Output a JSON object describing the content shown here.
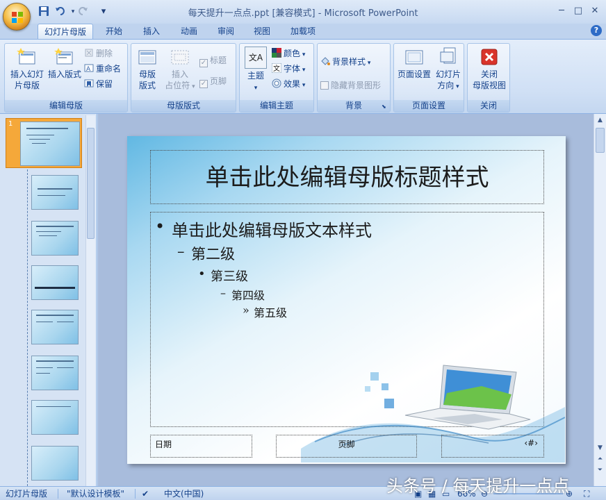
{
  "window": {
    "title": "每天提升一点点.ppt [兼容模式] - Microsoft PowerPoint",
    "minimize": "─",
    "restore": "□",
    "close": "✕"
  },
  "quick_access": {
    "save_icon": "save-icon",
    "undo_icon": "undo-icon",
    "redo_icon": "redo-icon",
    "customize": "▾"
  },
  "tabs": [
    {
      "label": "幻灯片母版",
      "active": true
    },
    {
      "label": "开始"
    },
    {
      "label": "插入"
    },
    {
      "label": "动画"
    },
    {
      "label": "审阅"
    },
    {
      "label": "视图"
    },
    {
      "label": "加载项"
    }
  ],
  "help": "?",
  "ribbon": {
    "edit_master": {
      "label": "编辑母版",
      "insert_master_l1": "插入幻灯",
      "insert_master_l2": "片母版",
      "insert_layout": "插入版式",
      "delete": "删除",
      "rename": "重命名",
      "preserve": "保留"
    },
    "master_layout": {
      "label": "母版版式",
      "layout_l1": "母版",
      "layout_l2": "版式",
      "placeholder_l1": "插入",
      "placeholder_l2": "占位符",
      "title_cb": "标题",
      "footer_cb": "页脚"
    },
    "edit_theme": {
      "label": "编辑主题",
      "themes": "主题",
      "colors": "颜色",
      "fonts": "字体",
      "effects": "效果",
      "theme_icon_text": "文A"
    },
    "background": {
      "label": "背景",
      "styles": "背景样式",
      "hide_graphics": "隐藏背景图形"
    },
    "page_setup": {
      "label": "页面设置",
      "setup": "页面设置",
      "orientation_l1": "幻灯片",
      "orientation_l2": "方向"
    },
    "close": {
      "label": "关闭",
      "close_l1": "关闭",
      "close_l2": "母版视图"
    }
  },
  "thumbnails": {
    "first_number": "1"
  },
  "slide": {
    "title": "单击此处编辑母版标题样式",
    "level1": "单击此处编辑母版文本样式",
    "level2": "第二级",
    "level3": "第三级",
    "level4": "第四级",
    "level5": "第五级",
    "bullet1": "•",
    "bullet2": "–",
    "bullet3": "•",
    "bullet4": "–",
    "bullet5": "»",
    "date": "日期",
    "footer": "页脚",
    "number": "‹#›"
  },
  "status": {
    "view": "幻灯片母版",
    "theme": "\"默认设计模板\"",
    "language": "中文(中国)",
    "zoom": "66%"
  },
  "watermark": "头条号 / 每天提升一点点"
}
